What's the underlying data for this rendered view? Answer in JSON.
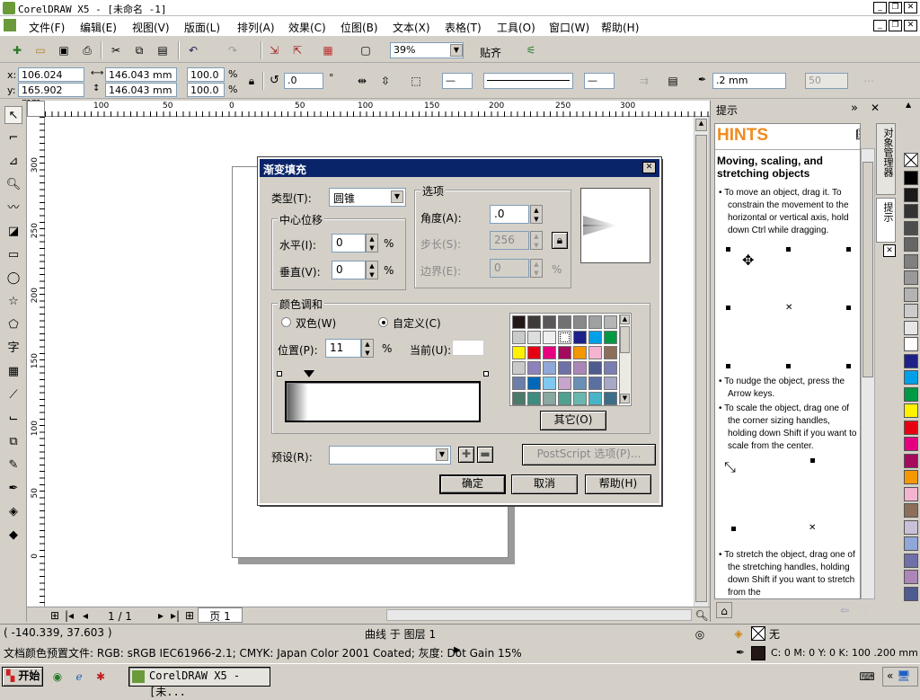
{
  "window": {
    "title": "CorelDRAW X5 - [未命名 -1]"
  },
  "menu": [
    "文件(F)",
    "编辑(E)",
    "视图(V)",
    "版面(L)",
    "排列(A)",
    "效果(C)",
    "位图(B)",
    "文本(X)",
    "表格(T)",
    "工具(O)",
    "窗口(W)",
    "帮助(H)"
  ],
  "toolbar": {
    "zoom": "39%",
    "snap_label": "贴齐"
  },
  "propbar": {
    "x_label": "x:",
    "x": "106.024 mm",
    "y_label": "y:",
    "y": "165.902 mm",
    "w": "146.043 mm",
    "h": "146.043 mm",
    "scale_w": "100.0",
    "scale_h": "100.0",
    "pct": "%",
    "rotation": ".0",
    "deg": "°",
    "outline_width": ".2 mm",
    "dim_value": "50"
  },
  "ruler_h": [
    "100",
    "50",
    "0",
    "50",
    "100",
    "150",
    "200",
    "250",
    "300"
  ],
  "ruler_v": [
    "300",
    "250",
    "200",
    "150",
    "100",
    "50",
    "0"
  ],
  "nav": {
    "page_count": "1 / 1",
    "page_tab": "页 1"
  },
  "docker": {
    "title": "提示",
    "tab1": "对象管理器",
    "tab2": "提示",
    "hints_title": "HINTS",
    "heading": "Moving, scaling, and stretching objects",
    "p1": "To move an object, drag it. To constrain the movement to the horizontal or vertical axis, hold down Ctrl while dragging.",
    "p2": "To nudge the object, press the Arrow keys.",
    "p3": "To scale the object, drag one of the corner sizing handles, holding down Shift if you want to scale from the center.",
    "p4": "To stretch the object, drag one of the stretching handles, holding down Shift if you want to stretch from the"
  },
  "dialog": {
    "title": "渐变填充",
    "type_label": "类型(T):",
    "type_value": "圆锥",
    "center_group": "中心位移",
    "horiz_label": "水平(I):",
    "horiz_value": "0",
    "vert_label": "垂直(V):",
    "vert_value": "0",
    "options_group": "选项",
    "angle_label": "角度(A):",
    "angle_value": ".0",
    "steps_label": "步长(S):",
    "steps_value": "256",
    "edge_label": "边界(E):",
    "edge_value": "0",
    "pct": "%",
    "blend_group": "颜色调和",
    "two_color": "双色(W)",
    "custom": "自定义(C)",
    "position_label": "位置(P):",
    "position_value": "11",
    "current_label": "当前(U):",
    "others_btn": "其它(O)",
    "preset_label": "预设(R):",
    "postscript_btn": "PostScript 选项(P)...",
    "ok": "确定",
    "cancel": "取消",
    "help": "帮助(H)",
    "palette_colors": [
      "#231815",
      "#3e3a39",
      "#595757",
      "#727171",
      "#898989",
      "#9fa0a0",
      "#b5b5b6",
      "#c9caca",
      "#dcdddd",
      "#efefef",
      "#ffffff",
      "#1d2088",
      "#00a0e9",
      "#009944",
      "#fff100",
      "#e60012",
      "#e4007f",
      "#a40b5d",
      "#f39800",
      "#f4b4d0",
      "#8c6e5a",
      "#c9caca",
      "#8f82bc",
      "#8fa8d8",
      "#6f70a8",
      "#aa87b8",
      "#4e5b8f",
      "#7a7eb0",
      "#6b7fa8",
      "#0068b7",
      "#80c8ee",
      "#c7a4cc",
      "#6a8fb5",
      "#5b6fa0",
      "#a8a8c8",
      "#4a7a6a",
      "#3e8c80",
      "#88a8a0",
      "#50a090",
      "#68b8b0",
      "#48b4c8",
      "#3c6e8a"
    ]
  },
  "status": {
    "coords": "( -140.339, 37.603 )",
    "object": "曲线 于 图层 1",
    "fill_none": "无",
    "profile": "文档颜色预置文件: RGB: sRGB IEC61966-2.1; CMYK: Japan Color 2001 Coated; 灰度: Dot Gain 15%",
    "outline": "C: 0 M: 0 Y: 0 K: 100  .200 mm"
  },
  "taskbar": {
    "start": "开始",
    "task": "CorelDRAW X5 - [未..."
  },
  "palette": [
    "#ffffff",
    "#000000",
    "#1a1a1a",
    "#333333",
    "#4d4d4d",
    "#666666",
    "#808080",
    "#999999",
    "#b3b3b3",
    "#cccccc",
    "#e6e6e6",
    "#ffffff",
    "#1d2088",
    "#00a0e9",
    "#009944",
    "#fff100",
    "#e60012",
    "#e4007f",
    "#a40b5d",
    "#f39800",
    "#f4b4d0",
    "#8c6e5a",
    "#c9c0d8",
    "#8fa8d8",
    "#6f70a8",
    "#aa87b8",
    "#4e5b8f"
  ]
}
